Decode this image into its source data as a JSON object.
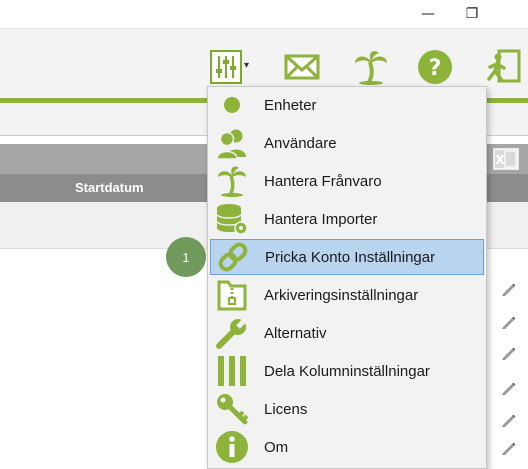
{
  "window": {
    "minimize_glyph": "—",
    "restore_glyph": "❐"
  },
  "toolbar": {
    "icons": [
      "settings-sliders-icon",
      "mail-icon",
      "palm-tree-icon",
      "help-icon",
      "exit-icon"
    ],
    "dropdown_glyph": "▾"
  },
  "grid": {
    "column_header": "Startdatum"
  },
  "badge": {
    "number": "1"
  },
  "menu": {
    "items": [
      {
        "label": "Enheter",
        "icon": "circle-icon"
      },
      {
        "label": "Användare",
        "icon": "users-icon"
      },
      {
        "label": "Hantera Frånvaro",
        "icon": "palm-tree-icon"
      },
      {
        "label": "Hantera Importer",
        "icon": "database-gear-icon"
      },
      {
        "label": "Pricka Konto Inställningar",
        "icon": "link-icon",
        "selected": true
      },
      {
        "label": "Arkiveringsinställningar",
        "icon": "archive-zip-icon"
      },
      {
        "label": "Alternativ",
        "icon": "wrench-icon"
      },
      {
        "label": "Dela Kolumninställningar",
        "icon": "columns-icon"
      },
      {
        "label": "Licens",
        "icon": "key-icon"
      },
      {
        "label": "Om",
        "icon": "info-icon"
      }
    ]
  },
  "colors": {
    "accent_green": "#8db33a",
    "selection_blue": "#b8d4ee",
    "badge_green": "#6f9a5c"
  }
}
